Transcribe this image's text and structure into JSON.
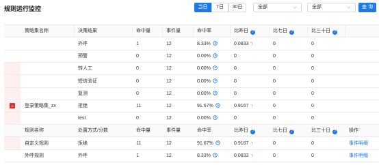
{
  "header": {
    "title": "规则运行监控",
    "ranges": [
      "当日",
      "7日",
      "30日"
    ],
    "active_range": "当日",
    "select1": "全部",
    "select2": "全部",
    "query": "查 询"
  },
  "colors": {
    "accent": "#1f79e3",
    "up_arrow": "#e02e2e",
    "expand_button": "#e02e2e"
  },
  "icons": {
    "help": "question-circle-icon",
    "rate": "clock-icon",
    "up": "arrow-up-icon",
    "expand": "minus-square-icon"
  },
  "top_table": {
    "headers": [
      "策略集名称",
      "决策结果",
      "命中量",
      "事件量",
      "命中率",
      "比昨日",
      "比七日",
      "比三十日"
    ],
    "group_name": "登录策略集_zx",
    "rows": [
      {
        "result": "外呼",
        "hits": "1",
        "events": "12",
        "rate": "8.33%",
        "vs_yesterday": "0.0833",
        "up": true,
        "vs_7": "0",
        "vs_30": "0"
      },
      {
        "result": "预警",
        "hits": "0",
        "events": "12",
        "rate": "0.00%",
        "vs_yesterday": "0",
        "up": false,
        "vs_7": "0",
        "vs_30": "0"
      },
      {
        "result": "转人工",
        "hits": "0",
        "events": "12",
        "rate": "0.00%",
        "vs_yesterday": "0",
        "up": false,
        "vs_7": "0",
        "vs_30": "0"
      },
      {
        "result": "短信验证",
        "hits": "0",
        "events": "12",
        "rate": "0.00%",
        "vs_yesterday": "0",
        "up": false,
        "vs_7": "0",
        "vs_30": "0"
      },
      {
        "result": "复测",
        "hits": "0",
        "events": "12",
        "rate": "0.00%",
        "vs_yesterday": "0",
        "up": false,
        "vs_7": "0",
        "vs_30": "0"
      },
      {
        "result": "拒绝",
        "hits": "11",
        "events": "12",
        "rate": "91.67%",
        "vs_yesterday": "0.9167",
        "up": true,
        "vs_7": "0",
        "vs_30": "0"
      },
      {
        "result": "test",
        "hits": "0",
        "events": "12",
        "rate": "0.00%",
        "vs_yesterday": "0",
        "up": false,
        "vs_7": "0",
        "vs_30": "0"
      }
    ]
  },
  "bottom_table": {
    "headers": [
      "规则名称",
      "处置方式/分数",
      "命中量",
      "事件量",
      "命中率",
      "比昨日",
      "比七日",
      "比三十日",
      "操作"
    ],
    "rows": [
      {
        "name": "自定义规则",
        "action": "拒绝",
        "hits": "11",
        "events": "12",
        "rate": "91.67%",
        "vs_yesterday": "0.9167",
        "up": true,
        "vs_7": "0",
        "vs_30": "0",
        "op": "事件明细"
      },
      {
        "name": "外呼规则",
        "action": "外呼",
        "hits": "1",
        "events": "12",
        "rate": "8.33%",
        "vs_yesterday": "0.0833",
        "up": true,
        "vs_7": "0",
        "vs_30": "0",
        "op": "事件明细"
      }
    ]
  }
}
